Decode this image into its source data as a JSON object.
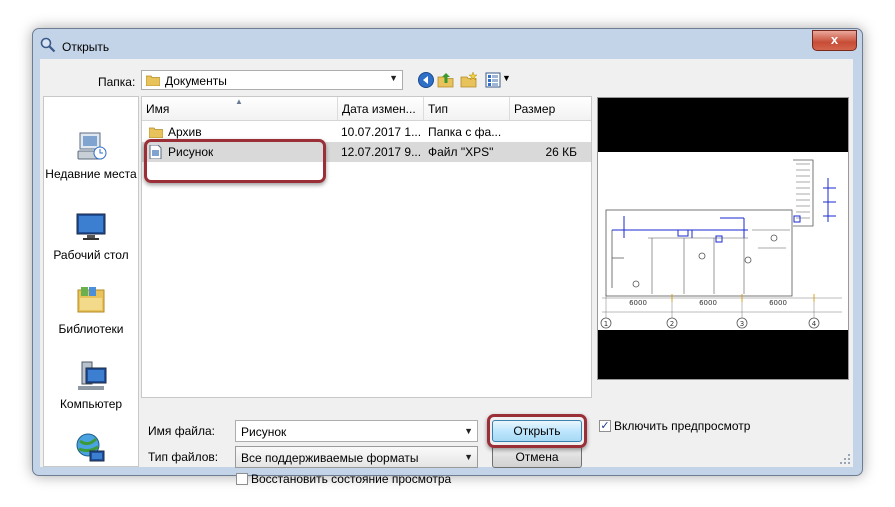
{
  "window": {
    "title": "Открыть",
    "close_glyph": "x"
  },
  "toolbar": {
    "folder_label": "Папка:",
    "folder_value": "Документы",
    "icons": [
      "back-icon",
      "up-folder-icon",
      "new-folder-icon",
      "view-menu-icon"
    ]
  },
  "places": [
    {
      "label": "Недавние места",
      "icon": "recent-places-icon"
    },
    {
      "label": "Рабочий стол",
      "icon": "desktop-icon"
    },
    {
      "label": "Библиотеки",
      "icon": "libraries-icon"
    },
    {
      "label": "Компьютер",
      "icon": "computer-icon"
    },
    {
      "label": "",
      "icon": "network-icon"
    }
  ],
  "columns": [
    "Имя",
    "Дата измен...",
    "Тип",
    "Размер"
  ],
  "files": [
    {
      "name": "Архив",
      "date": "10.07.2017 1...",
      "type": "Папка с фа...",
      "size": "",
      "icon": "folder-icon"
    },
    {
      "name": "Рисунок",
      "date": "12.07.2017 9...",
      "type": "Файл \"XPS\"",
      "size": "26 КБ",
      "icon": "xps-file-icon"
    }
  ],
  "filename": {
    "label": "Имя файла:",
    "value": "Рисунок"
  },
  "filetype": {
    "label": "Тип файлов:",
    "value": "Все поддерживаемые форматы"
  },
  "buttons": {
    "open": "Открыть",
    "cancel": "Отмена"
  },
  "preview_checkbox": {
    "label": "Включить предпросмотр",
    "checked": true
  },
  "restore_checkbox": {
    "label": "Восстановить состояние просмотра",
    "checked": false
  },
  "preview": {
    "dimension_labels": [
      "6000",
      "6000",
      "6000"
    ],
    "axis_labels": [
      "1",
      "2",
      "3",
      "4"
    ]
  },
  "colors": {
    "highlight": "#9b2f38",
    "window_frame": "#c4d4e8",
    "selection": "#d9d9d9"
  }
}
